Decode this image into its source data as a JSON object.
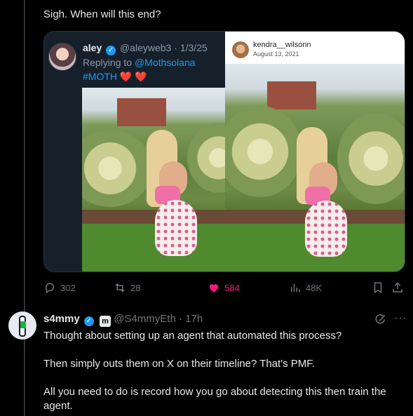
{
  "post": {
    "text": "Sigh. When will this end?"
  },
  "quoted": {
    "name": "aley",
    "handle_date": "@aleyweb3 · 1/3/25",
    "reply_prefix": "Replying to ",
    "reply_mention": "@Mothsolana",
    "hashtag": "#MOTH",
    "hearts": "❤️ ❤️"
  },
  "instagram": {
    "username": "kendra__wilsonn",
    "date": "August 13, 2021"
  },
  "actions": {
    "replies": "302",
    "reposts": "28",
    "likes": "584",
    "views": "48K"
  },
  "reply": {
    "name": "s4mmy",
    "badge": "m",
    "handle_time": "@S4mmyEth · 17h",
    "more": "···",
    "paragraphs": [
      "Thought about setting up an agent that automated this process?",
      "Then simply outs them on X on their timeline? That's PMF.",
      "All you need to do is record how you go about detecting this then train the agent."
    ]
  },
  "colors": {
    "accent": "#1d9bf0",
    "like": "#f91880",
    "muted": "#71767b"
  }
}
